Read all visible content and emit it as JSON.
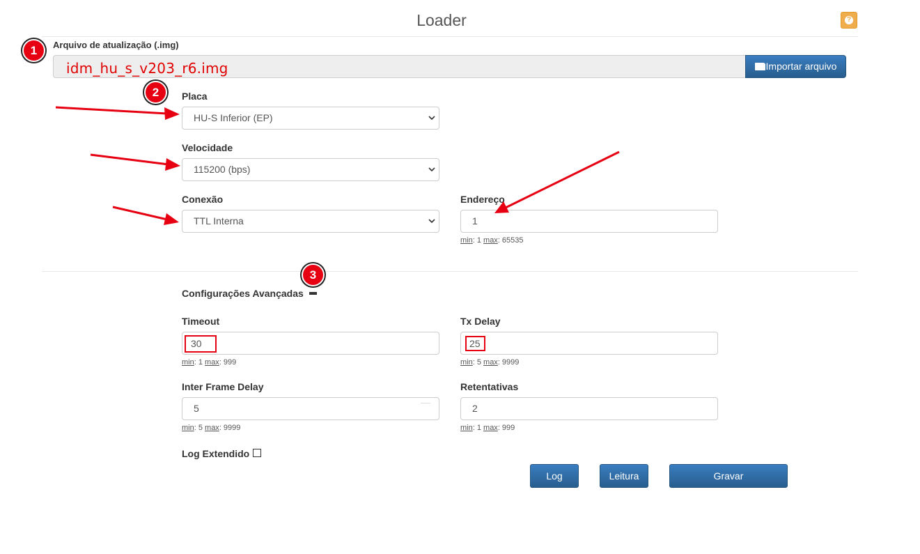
{
  "header": {
    "title": "Loader",
    "help_icon": "question-circle-icon"
  },
  "annotations": {
    "step1": "1",
    "step2": "2",
    "step3": "3",
    "color": "#e60012"
  },
  "file": {
    "label": "Arquivo de atualização (.img)",
    "filename": "idm_hu_s_v203_r6.img",
    "import_label": "Importar arquivo",
    "import_icon": "folder-open-icon"
  },
  "placa": {
    "label": "Placa",
    "value": "HU-S Inferior (EP)"
  },
  "velocidade": {
    "label": "Velocidade",
    "value": "115200 (bps)"
  },
  "conexao": {
    "label": "Conexão",
    "value": "TTL Interna"
  },
  "endereco": {
    "label": "Endereço",
    "value": "1",
    "min_label": "min",
    "min": ": 1 ",
    "max_label": "max",
    "max": ": 65535"
  },
  "advanced": {
    "title": "Configurações Avançadas",
    "toggle_icon": "minus-icon"
  },
  "timeout": {
    "label": "Timeout",
    "value": "30",
    "min_label": "min",
    "min": ": 1 ",
    "max_label": "max",
    "max": ": 999"
  },
  "txdelay": {
    "label": "Tx Delay",
    "value": "25",
    "min_label": "min",
    "min": ": 5 ",
    "max_label": "max",
    "max": ": 9999"
  },
  "interframe": {
    "label": "Inter Frame Delay",
    "value": "5",
    "min_label": "min",
    "min": ": 5 ",
    "max_label": "max",
    "max": ": 9999"
  },
  "retentativas": {
    "label": "Retentativas",
    "value": "2",
    "min_label": "min",
    "min": ": 1 ",
    "max_label": "max",
    "max": ": 999"
  },
  "log_extendido": {
    "label": "Log Extendido",
    "checked": false
  },
  "actions": {
    "log": "Log",
    "leitura": "Leitura",
    "gravar": "Gravar"
  },
  "colors": {
    "primary": "#337ab7",
    "help": "#f0ad4e",
    "filename": "#e00000"
  }
}
